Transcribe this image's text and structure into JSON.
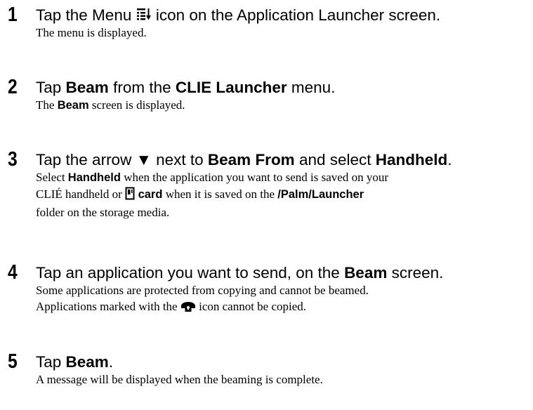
{
  "steps": [
    {
      "number": "1",
      "head": {
        "t1": "Tap the Menu ",
        "icon": "menu-icon",
        "t2": " icon on the Application Launcher screen."
      },
      "body": {
        "line1": "The menu is displayed."
      }
    },
    {
      "number": "2",
      "head": {
        "t1": "Tap ",
        "b1": "Beam",
        "t2": " from the ",
        "b2": "CLIE Launcher",
        "t3": " menu."
      },
      "body": {
        "t1": "The ",
        "b1": "Beam",
        "t2": " screen is displayed."
      }
    },
    {
      "number": "3",
      "head": {
        "t1": "Tap the arrow ",
        "arrow": "▼",
        "t2": " next to ",
        "b1": "Beam From",
        "t3": " and select ",
        "b2": "Handheld",
        "t4": "."
      },
      "body": {
        "l1_t1": "Select ",
        "l1_b1": "Handheld",
        "l1_t2": " when the application you want to send is saved on your",
        "l2_t1": "CLIÉ handheld or ",
        "l2_icon": "memory-card-icon",
        "l2_b1": " card",
        "l2_t2": " when it is saved on the ",
        "l2_b2": "/Palm/Launcher",
        "l3": "folder on the storage media."
      }
    },
    {
      "number": "4",
      "head": {
        "t1": "Tap an application you want to send, on the ",
        "b1": "Beam",
        "t2": " screen."
      },
      "body": {
        "line1": "Some applications are protected from copying and cannot be beamed.",
        "l2_t1": "Applications marked with the ",
        "l2_icon": "lock-icon",
        "l2_t2": " icon cannot be copied."
      }
    },
    {
      "number": "5",
      "head": {
        "t1": "Tap ",
        "b1": "Beam",
        "t2": "."
      },
      "body": {
        "line1": "A message will be displayed when the beaming is complete."
      }
    }
  ]
}
